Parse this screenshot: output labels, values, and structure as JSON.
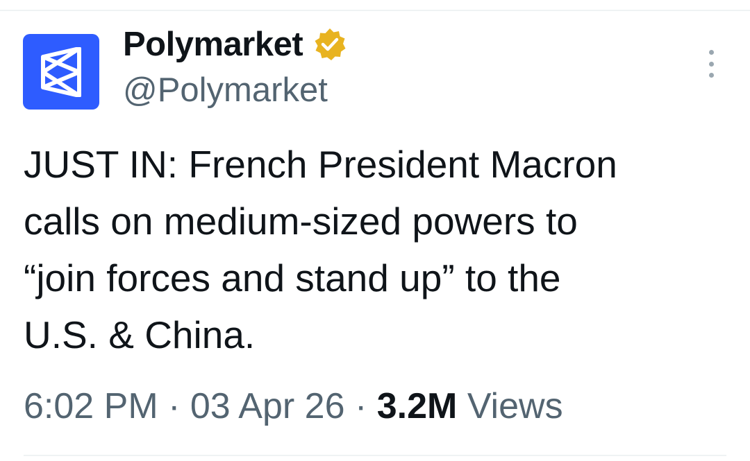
{
  "author": {
    "display_name": "Polymarket",
    "handle": "@Polymarket",
    "verified_icon": "verified-badge-gold",
    "avatar_icon": "polymarket-logo",
    "avatar_color": "#2e5cff"
  },
  "tweet": {
    "lines": [
      "JUST IN: French President Macron",
      "calls on medium-sized powers to",
      "“join forces and stand up” to the",
      "U.S. & China."
    ]
  },
  "meta": {
    "time": "6:02 PM",
    "separator": "·",
    "date": "03 Apr 26",
    "views_count": "3.2M",
    "views_label": "Views"
  },
  "colors": {
    "text_primary": "#0f1419",
    "text_secondary": "#536471",
    "badge_gold": "#e8b320"
  }
}
